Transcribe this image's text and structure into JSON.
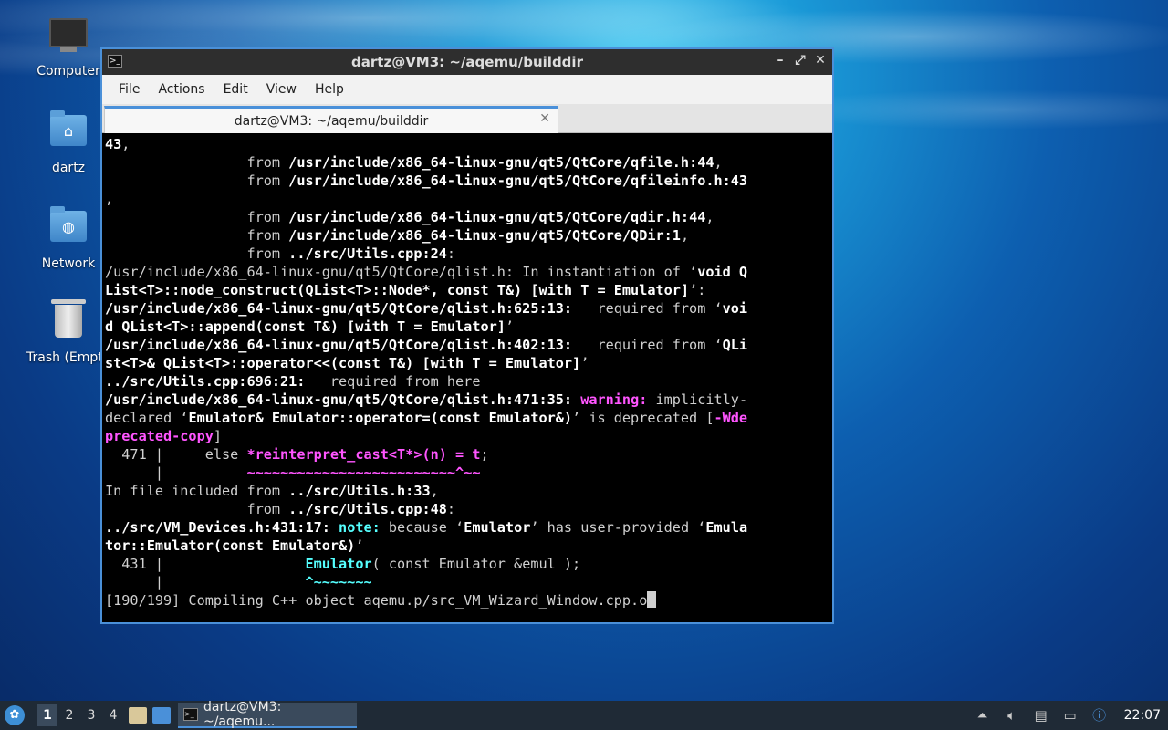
{
  "desktop": {
    "icons": [
      {
        "label": "Computer"
      },
      {
        "label": "dartz"
      },
      {
        "label": "Network"
      },
      {
        "label": "Trash (Empty)"
      }
    ]
  },
  "window": {
    "title": "dartz@VM3: ~/aqemu/builddir",
    "controls": {
      "minimize": "–",
      "maximize": "⤢",
      "close": "✕"
    },
    "menu": [
      "File",
      "Actions",
      "Edit",
      "View",
      "Help"
    ],
    "tab": {
      "label": "dartz@VM3: ~/aqemu/builddir",
      "close": "✕"
    }
  },
  "terminal": {
    "lines": [
      [
        {
          "t": "43",
          "s": "b"
        },
        {
          "t": ","
        }
      ],
      [
        {
          "t": "                 from "
        },
        {
          "t": "/usr/include/x86_64-linux-gnu/qt5/QtCore/qfile.h:44",
          "s": "b"
        },
        {
          "t": ","
        }
      ],
      [
        {
          "t": "                 from "
        },
        {
          "t": "/usr/include/x86_64-linux-gnu/qt5/QtCore/qfileinfo.h:43",
          "s": "b"
        }
      ],
      [
        {
          "t": ","
        }
      ],
      [
        {
          "t": "                 from "
        },
        {
          "t": "/usr/include/x86_64-linux-gnu/qt5/QtCore/qdir.h:44",
          "s": "b"
        },
        {
          "t": ","
        }
      ],
      [
        {
          "t": "                 from "
        },
        {
          "t": "/usr/include/x86_64-linux-gnu/qt5/QtCore/QDir:1",
          "s": "b"
        },
        {
          "t": ","
        }
      ],
      [
        {
          "t": "                 from "
        },
        {
          "t": "../src/Utils.cpp:24",
          "s": "b"
        },
        {
          "t": ":"
        }
      ],
      [
        {
          "t": "/usr/include/x86_64-linux-gnu/qt5/QtCore/qlist.h:"
        },
        {
          "t": " In instantiation of ‘"
        },
        {
          "t": "void Q",
          "s": "b"
        }
      ],
      [
        {
          "t": "List<T>::node_construct(QList<T>::Node*, const T&) [with T = Emulator]",
          "s": "b"
        },
        {
          "t": "’:"
        }
      ],
      [
        {
          "t": "/usr/include/x86_64-linux-gnu/qt5/QtCore/qlist.h:625:13:",
          "s": "b"
        },
        {
          "t": "   required from ‘"
        },
        {
          "t": "voi",
          "s": "b"
        }
      ],
      [
        {
          "t": "d QList<T>::append(const T&) [with T = Emulator]",
          "s": "b"
        },
        {
          "t": "’"
        }
      ],
      [
        {
          "t": "/usr/include/x86_64-linux-gnu/qt5/QtCore/qlist.h:402:13:",
          "s": "b"
        },
        {
          "t": "   required from ‘"
        },
        {
          "t": "QLi",
          "s": "b"
        }
      ],
      [
        {
          "t": "st<T>& QList<T>::operator<<(const T&) [with T = Emulator]",
          "s": "b"
        },
        {
          "t": "’"
        }
      ],
      [
        {
          "t": "../src/Utils.cpp:696:21:",
          "s": "b"
        },
        {
          "t": "   required from here"
        }
      ],
      [
        {
          "t": "/usr/include/x86_64-linux-gnu/qt5/QtCore/qlist.h:471:35:",
          "s": "b"
        },
        {
          "t": " "
        },
        {
          "t": "warning:",
          "s": "m"
        },
        {
          "t": " implicitly-"
        }
      ],
      [
        {
          "t": "declared ‘"
        },
        {
          "t": "Emulator& Emulator::operator=(const Emulator&)",
          "s": "b"
        },
        {
          "t": "’ is deprecated ["
        },
        {
          "t": "-Wde",
          "s": "m"
        }
      ],
      [
        {
          "t": "precated-copy",
          "s": "m"
        },
        {
          "t": "]"
        }
      ],
      [
        {
          "t": "  471 |     else "
        },
        {
          "t": "*reinterpret_cast<T*>(n) = t",
          "s": "m"
        },
        {
          "t": ";"
        }
      ],
      [
        {
          "t": "      |          "
        },
        {
          "t": "~~~~~~~~~~~~~~~~~~~~~~~~~^~~",
          "s": "m"
        }
      ],
      [
        {
          "t": "In file included from "
        },
        {
          "t": "../src/Utils.h:33",
          "s": "b"
        },
        {
          "t": ","
        }
      ],
      [
        {
          "t": "                 from "
        },
        {
          "t": "../src/Utils.cpp:48",
          "s": "b"
        },
        {
          "t": ":"
        }
      ],
      [
        {
          "t": "../src/VM_Devices.h:431:17:",
          "s": "b"
        },
        {
          "t": " "
        },
        {
          "t": "note:",
          "s": "c"
        },
        {
          "t": " because ‘"
        },
        {
          "t": "Emulator",
          "s": "b"
        },
        {
          "t": "’ has user-provided ‘"
        },
        {
          "t": "Emula",
          "s": "b"
        }
      ],
      [
        {
          "t": "tor::Emulator(const Emulator&)",
          "s": "b"
        },
        {
          "t": "’"
        }
      ],
      [
        {
          "t": "  431 |                 "
        },
        {
          "t": "Emulator",
          "s": "c"
        },
        {
          "t": "( const Emulator &emul );"
        }
      ],
      [
        {
          "t": "      |                 "
        },
        {
          "t": "^~~~~~~~",
          "s": "c"
        }
      ],
      [
        {
          "t": "[190/199] Compiling C++ object aqemu.p/src_VM_Wizard_Window.cpp.o"
        },
        {
          "t": "",
          "s": "cursor"
        }
      ]
    ]
  },
  "taskbar": {
    "workspaces": [
      "1",
      "2",
      "3",
      "4"
    ],
    "active_workspace": "1",
    "task_label": "dartz@VM3: ~/aqemu...",
    "clock": "22:07",
    "tray_icons": [
      "arrow-up-icon",
      "volume-icon",
      "clipboard-icon",
      "network-icon",
      "update-notifier-icon"
    ]
  },
  "colors": {
    "accent": "#4a90d9",
    "warning": "#ff55ff",
    "note": "#55ffff",
    "terminal_bg": "#000000"
  }
}
